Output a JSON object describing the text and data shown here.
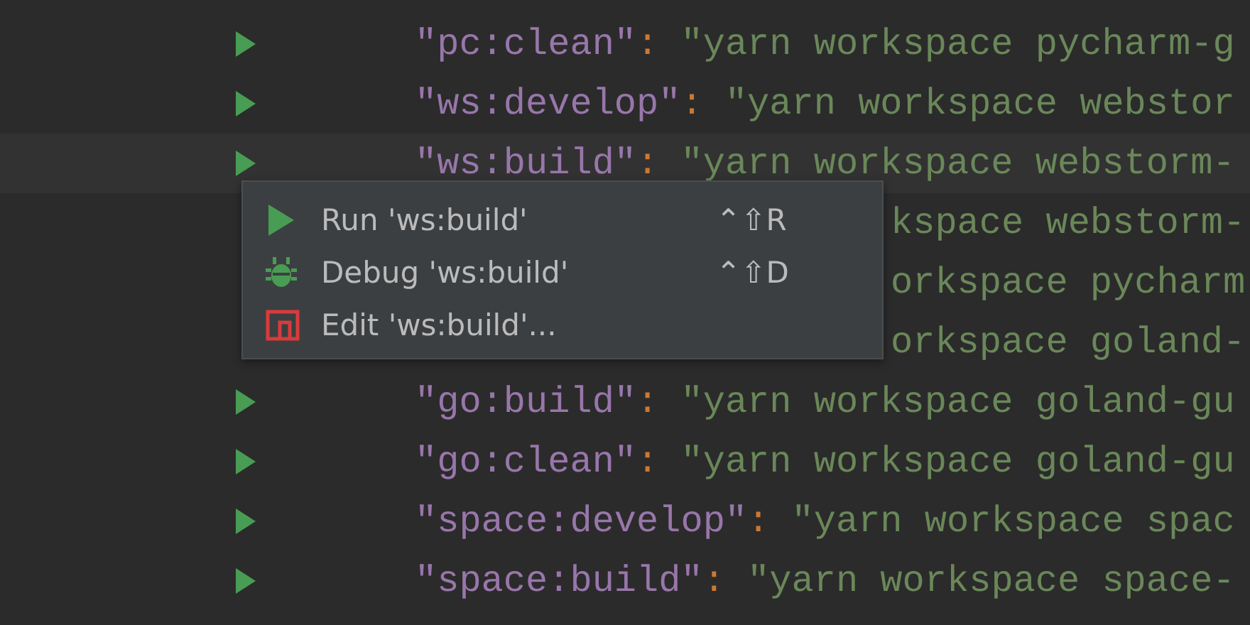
{
  "editor": {
    "lines": [
      {
        "kind": "code",
        "key": "\"pc:clean\"",
        "colon": ":",
        "value": "\"yarn workspace pycharm-g",
        "current": false
      },
      {
        "kind": "code",
        "key": "\"ws:develop\"",
        "colon": ":",
        "value": "\"yarn workspace webstor",
        "current": false
      },
      {
        "kind": "code",
        "key": "\"ws:build\"",
        "colon": ":",
        "value": "\"yarn workspace webstorm-",
        "current": true
      },
      {
        "kind": "covered",
        "fragment": "kspace webstorm-",
        "current": false
      },
      {
        "kind": "covered",
        "fragment": "orkspace pycharm",
        "current": false
      },
      {
        "kind": "covered",
        "fragment": "orkspace goland-",
        "current": false
      },
      {
        "kind": "code",
        "key": "\"go:build\"",
        "colon": ":",
        "value": "\"yarn workspace goland-gu",
        "current": false
      },
      {
        "kind": "code",
        "key": "\"go:clean\"",
        "colon": ":",
        "value": "\"yarn workspace goland-gu",
        "current": false
      },
      {
        "kind": "code",
        "key": "\"space:develop\"",
        "colon": ":",
        "value": "\"yarn workspace spac",
        "current": false
      },
      {
        "kind": "code",
        "key": "\"space:build\"",
        "colon": ":",
        "value": "\"yarn workspace space-",
        "current": false
      }
    ]
  },
  "popup_menu": {
    "items": [
      {
        "kind": "run",
        "label": "Run 'ws:build'",
        "shortcut": "⌃⇧R"
      },
      {
        "kind": "debug",
        "label": "Debug 'ws:build'",
        "shortcut": "⌃⇧D"
      },
      {
        "kind": "edit",
        "label": "Edit 'ws:build'..."
      }
    ]
  }
}
